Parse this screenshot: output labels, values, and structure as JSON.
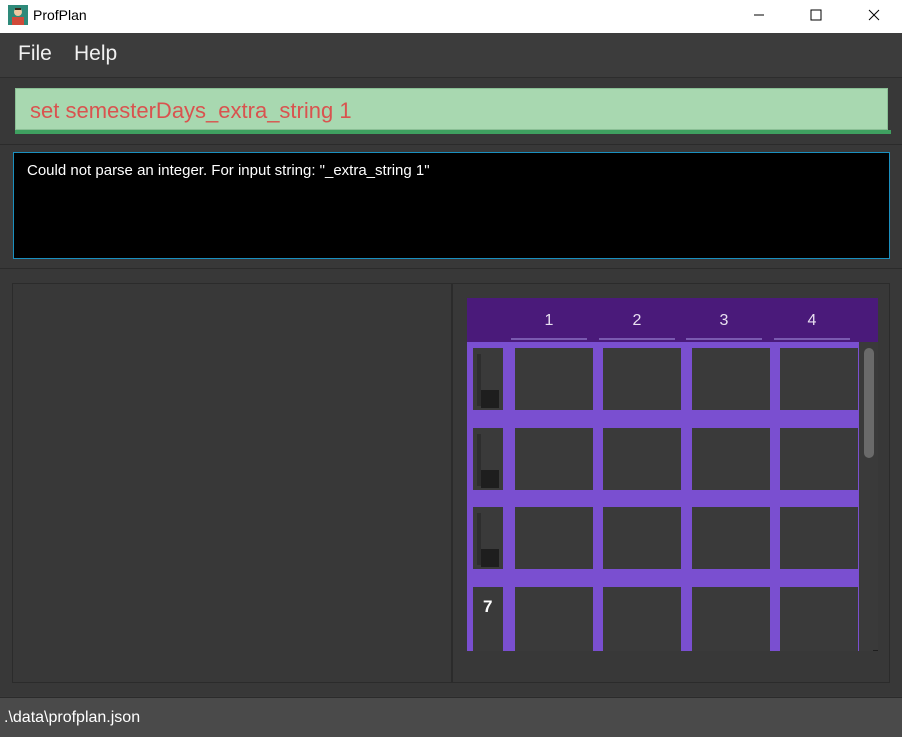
{
  "window": {
    "title": "ProfPlan",
    "icon": "profplan-app-icon",
    "controls": [
      "minimize-icon",
      "maximize-icon",
      "close-icon"
    ]
  },
  "menu": {
    "file_label": "File",
    "help_label": "Help"
  },
  "command": {
    "value": "set semesterDays_extra_string 1",
    "text_color": "#d9534f",
    "background_color": "#a8d8b0"
  },
  "result": {
    "message": "Could not parse an integer. For input string: \"_extra_string 1\""
  },
  "calendar": {
    "header_color": "#4a1a7a",
    "grid_color": "#7a4fd0",
    "columns": [
      "1",
      "2",
      "3",
      "4"
    ],
    "rows": [
      {
        "day_label": ""
      },
      {
        "day_label": ""
      },
      {
        "day_label": ""
      },
      {
        "day_label": "7"
      }
    ]
  },
  "status": {
    "file_path": ".\\data\\profplan.json"
  }
}
